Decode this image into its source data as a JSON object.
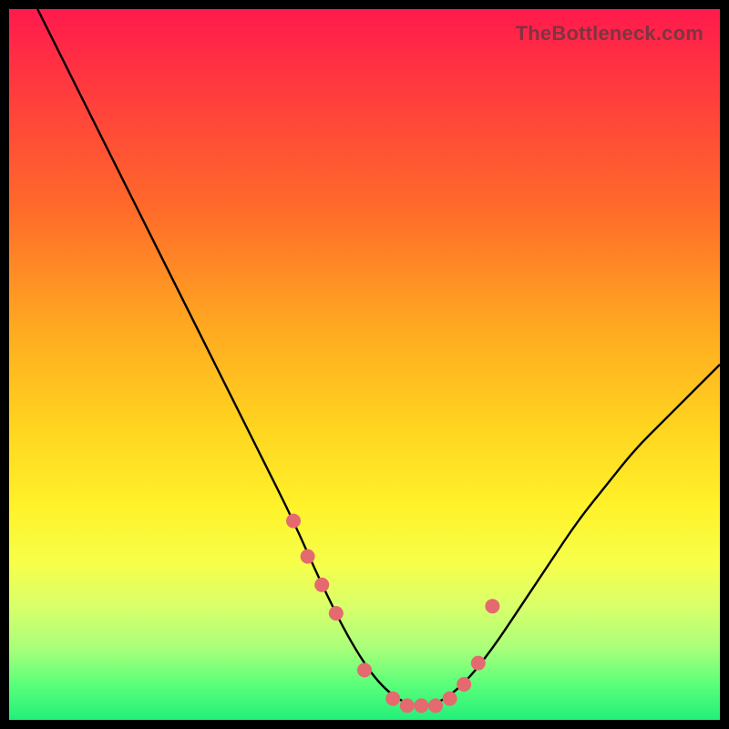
{
  "watermark": "TheBottleneck.com",
  "chart_data": {
    "type": "line",
    "title": "",
    "xlabel": "",
    "ylabel": "",
    "xlim": [
      0,
      100
    ],
    "ylim": [
      0,
      100
    ],
    "grid": false,
    "legend": false,
    "background_gradient": {
      "top": "#ff1a4d",
      "bottom": "#22f07a",
      "meaning_top": "high bottleneck",
      "meaning_bottom": "no bottleneck"
    },
    "series": [
      {
        "name": "bottleneck-curve",
        "color": "#000000",
        "x": [
          4,
          8,
          12,
          16,
          20,
          24,
          28,
          32,
          36,
          40,
          44,
          48,
          52,
          56,
          60,
          64,
          68,
          72,
          76,
          80,
          84,
          88,
          92,
          96,
          100
        ],
        "y": [
          100,
          92,
          84,
          76,
          68,
          60,
          52,
          44,
          36,
          28,
          19,
          11,
          5,
          2,
          2,
          5,
          10,
          16,
          22,
          28,
          33,
          38,
          42,
          46,
          50
        ]
      },
      {
        "name": "highlight-dots",
        "color": "#e46a6f",
        "marker": "circle",
        "x": [
          40,
          42,
          44,
          46,
          50,
          54,
          56,
          58,
          60,
          62,
          64,
          66,
          68
        ],
        "y": [
          28,
          23,
          19,
          15,
          7,
          3,
          2,
          2,
          2,
          3,
          5,
          8,
          16
        ]
      }
    ],
    "annotations": [],
    "notes": "V-shaped curve on red-to-green vertical gradient. Minimum ~x=57, y≈2. Red/pink dots cluster near the trough between x≈40 and x≈68."
  }
}
